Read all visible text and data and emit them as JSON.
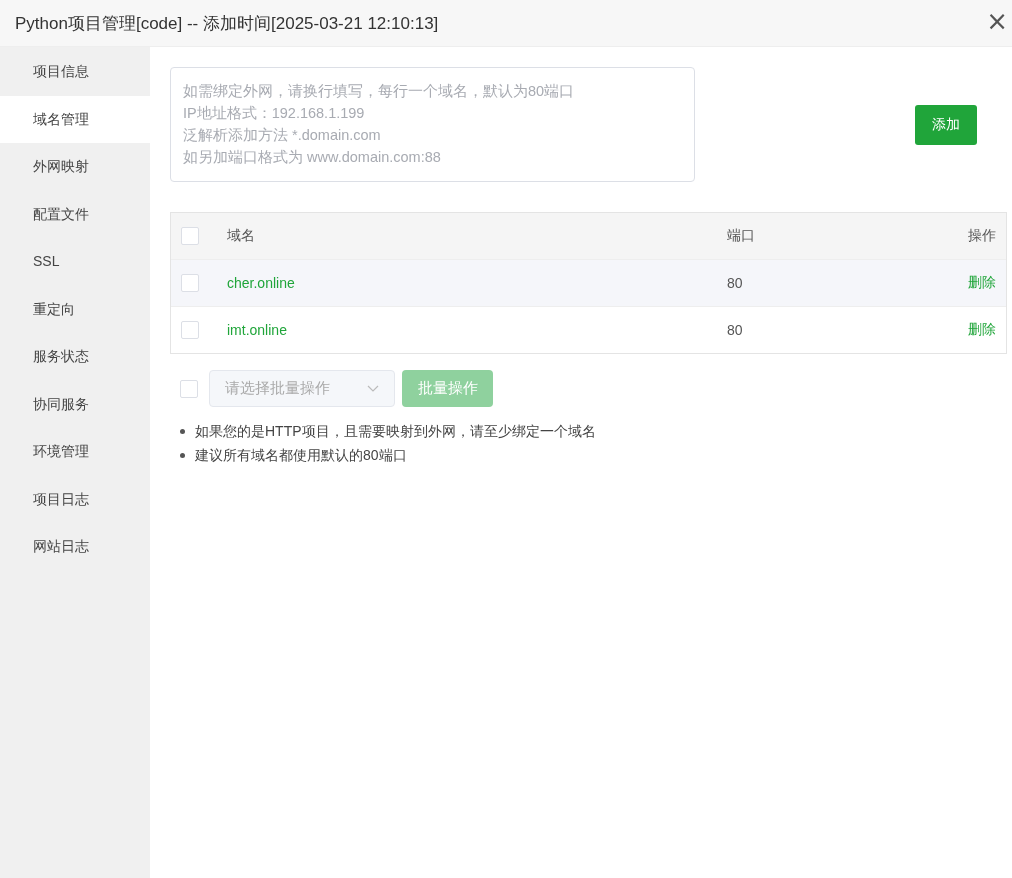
{
  "window": {
    "title": "Python项目管理[code] -- 添加时间[2025-03-21 12:10:13]",
    "close": "×"
  },
  "sidebar": {
    "items": [
      {
        "label": "项目信息",
        "selected": false
      },
      {
        "label": "域名管理",
        "selected": true
      },
      {
        "label": "外网映射",
        "selected": false
      },
      {
        "label": "配置文件",
        "selected": false
      },
      {
        "label": "SSL",
        "selected": false
      },
      {
        "label": "重定向",
        "selected": false
      },
      {
        "label": "服务状态",
        "selected": false
      },
      {
        "label": "协同服务",
        "selected": false
      },
      {
        "label": "环境管理",
        "selected": false
      },
      {
        "label": "项目日志",
        "selected": false
      },
      {
        "label": "网站日志",
        "selected": false
      }
    ]
  },
  "domain_input": {
    "placeholder": "如需绑定外网，请换行填写，每行一个域名，默认为80端口\nIP地址格式：192.168.1.199\n泛解析添加方法 *.domain.com\n如另加端口格式为 www.domain.com:88"
  },
  "add_button": "添加",
  "table": {
    "select_all_checked": false,
    "columns": [
      "域名",
      "端口",
      "操作"
    ],
    "rows": [
      {
        "checked": false,
        "domain": "cher.online",
        "port": "80",
        "action": "删除"
      },
      {
        "checked": false,
        "domain": "imt.online",
        "port": "80",
        "action": "删除"
      }
    ]
  },
  "batch": {
    "checked": false,
    "placeholder": "请选择批量操作",
    "button": "批量操作",
    "disabled": true
  },
  "notes": [
    "如果您的是HTTP项目，且需要映射到外网，请至少绑定一个域名",
    "建议所有域名都使用默认的80端口"
  ]
}
